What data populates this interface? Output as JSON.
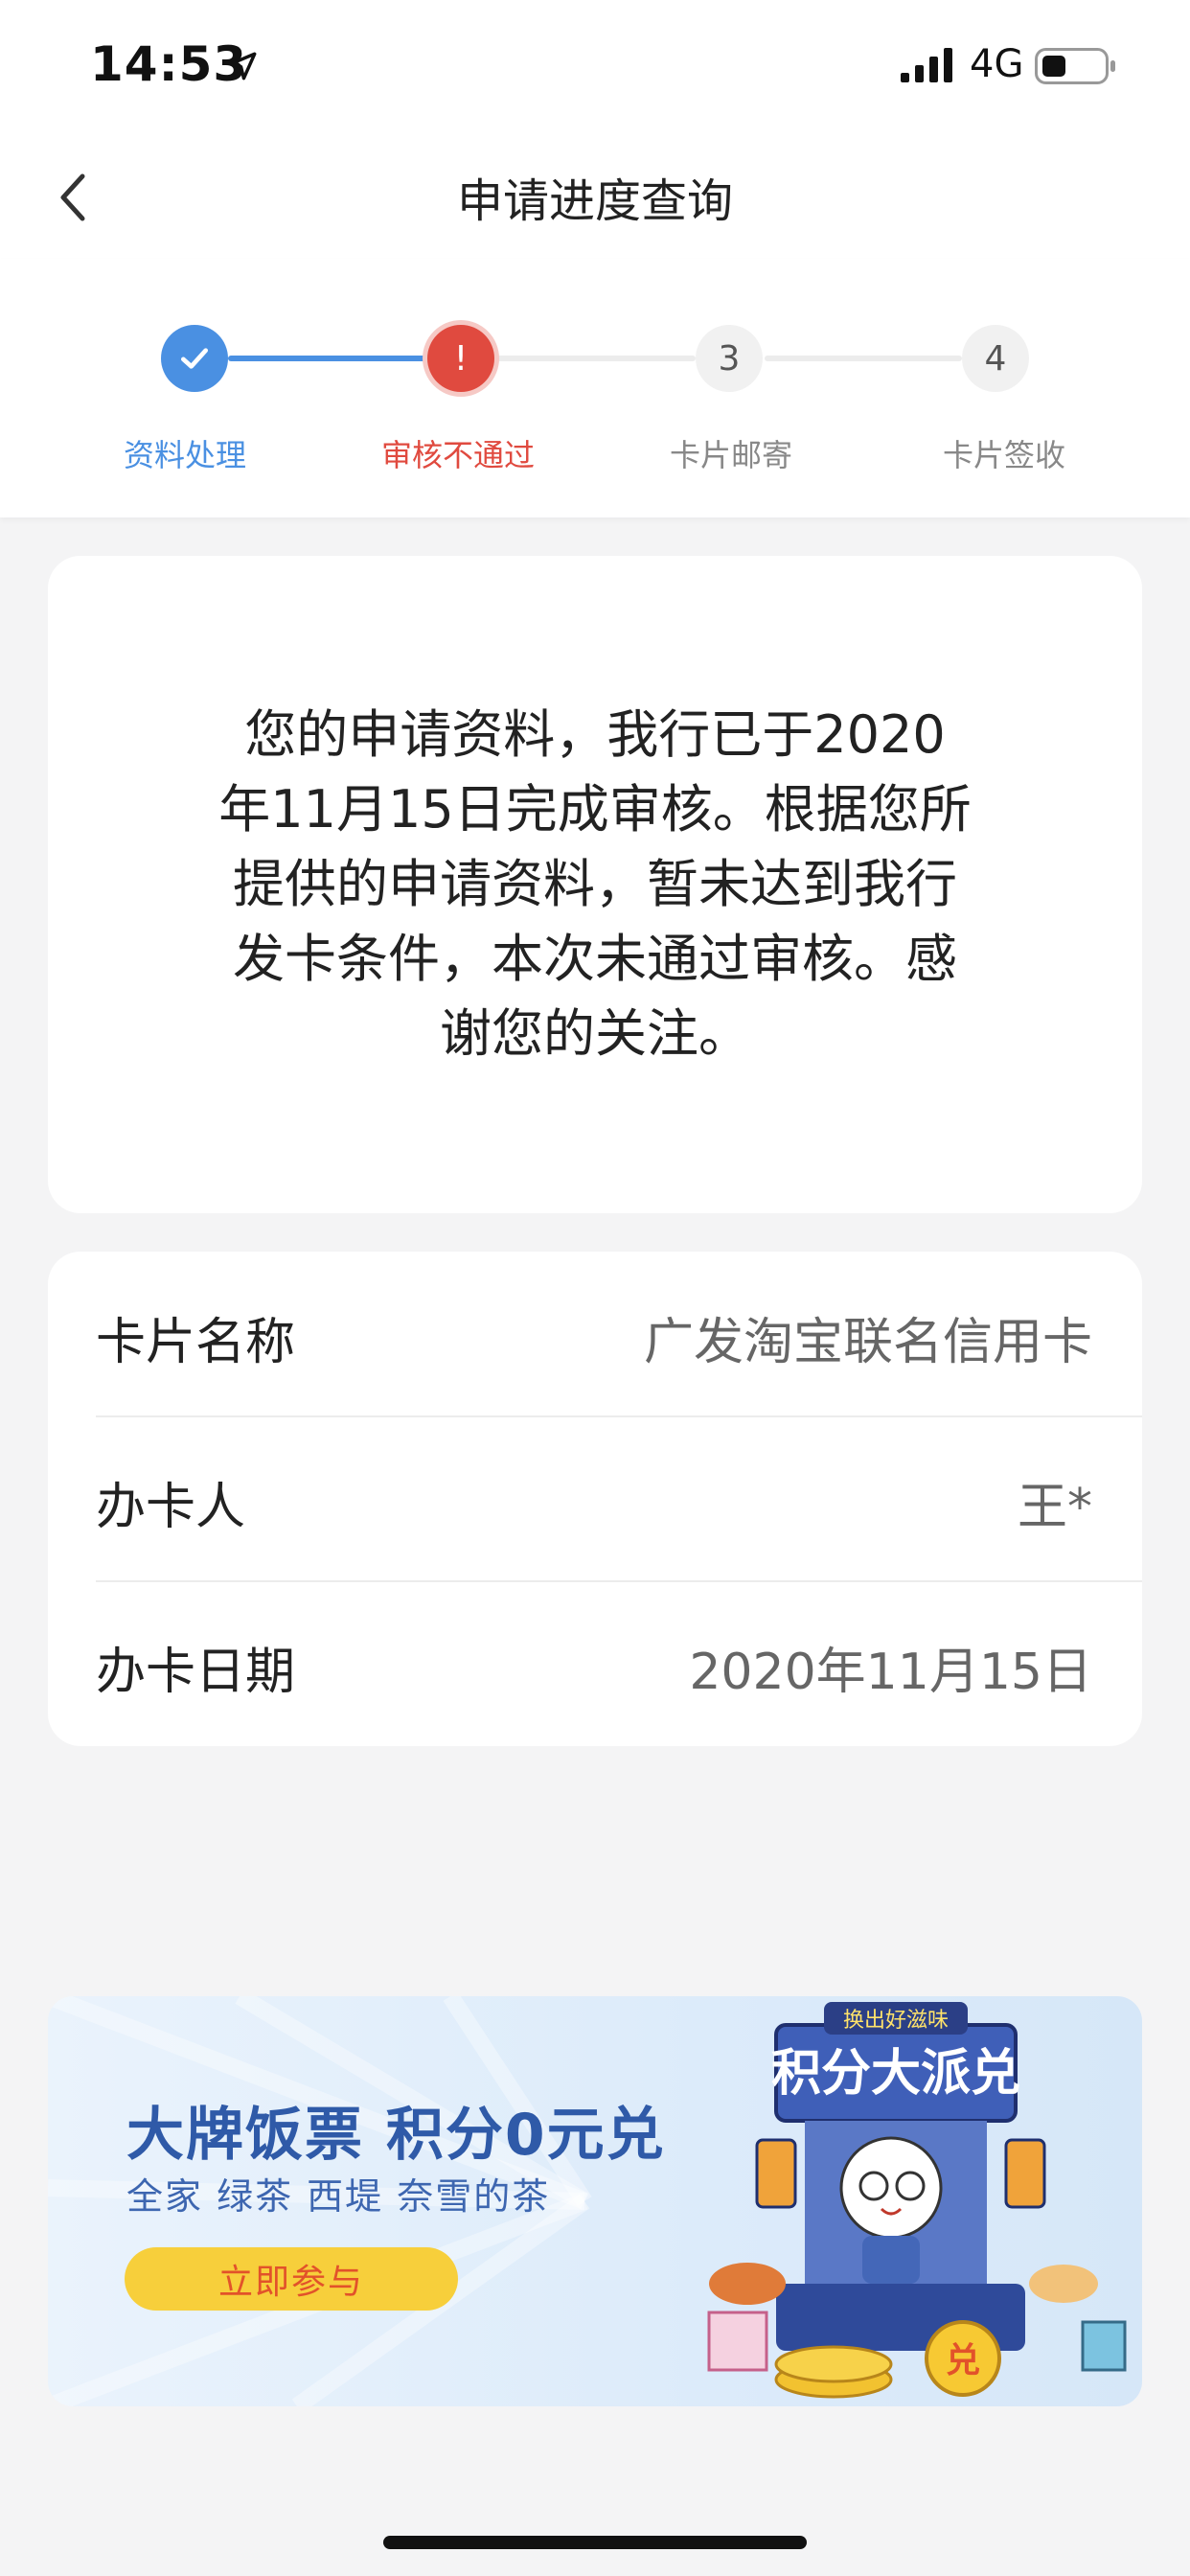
{
  "status_bar": {
    "time": "14:53",
    "network": "4G"
  },
  "nav": {
    "title": "申请进度查询"
  },
  "steps": [
    {
      "label": "资料处理",
      "marker": "✓",
      "state": "done",
      "color": "#4a90e2"
    },
    {
      "label": "审核不通过",
      "marker": "!",
      "state": "failed",
      "color": "#e04a3f"
    },
    {
      "label": "卡片邮寄",
      "marker": "3",
      "state": "pending",
      "color": "#888888"
    },
    {
      "label": "卡片签收",
      "marker": "4",
      "state": "pending",
      "color": "#888888"
    }
  ],
  "message": {
    "lines": [
      "您的申请资料，我行已于2020",
      "年11月15日完成审核。根据您所",
      "提供的申请资料，暂未达到我行",
      "发卡条件，本次未通过审核。感",
      "谢您的关注。"
    ]
  },
  "info": [
    {
      "key": "卡片名称",
      "value": "广发淘宝联名信用卡"
    },
    {
      "key": "办卡人",
      "value": "王*"
    },
    {
      "key": "办卡日期",
      "value": "2020年11月15日"
    }
  ],
  "banner": {
    "title": "大牌饭票 积分0元兑",
    "subtitle": "全家 绿茶 西堤 奈雪的茶",
    "button": "立即参与",
    "art_ribbon": "换出好滋味",
    "art_sign": "积分大派兑",
    "art_coin": "兑"
  },
  "colors": {
    "accent": "#4a90e2",
    "error": "#e04a3f",
    "background": "#f4f4f5"
  }
}
